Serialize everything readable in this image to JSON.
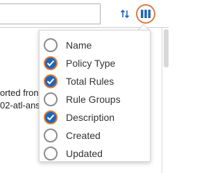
{
  "background": {
    "text_line_1": "orted fron",
    "text_line_2": "02-atl-ans"
  },
  "toolbar": {
    "sort_icon": "sort-arrows-icon",
    "columns_icon": "columns-icon"
  },
  "column_chooser": {
    "options": [
      {
        "label": "Name",
        "checked": false
      },
      {
        "label": "Policy Type",
        "checked": true
      },
      {
        "label": "Total Rules",
        "checked": true
      },
      {
        "label": "Rule Groups",
        "checked": false
      },
      {
        "label": "Description",
        "checked": true
      },
      {
        "label": "Created",
        "checked": false
      },
      {
        "label": "Updated",
        "checked": false
      }
    ]
  },
  "colors": {
    "accent_orange": "#e07a3a",
    "checked_fill": "#1f66b8",
    "columns_icon_blue": "#1f66b8"
  }
}
